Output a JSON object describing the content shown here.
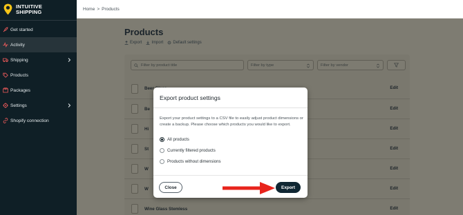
{
  "brand": {
    "line1": "INTUITIVE",
    "line2": "SHIPPING",
    "accent": "#f5c518"
  },
  "sidebar": {
    "items": [
      {
        "label": "Get started",
        "icon": "rocket-icon"
      },
      {
        "label": "Activity",
        "icon": "activity-icon",
        "active": true
      },
      {
        "label": "Shipping",
        "icon": "truck-icon",
        "has_children": true
      },
      {
        "label": "Products",
        "icon": "tag-icon"
      },
      {
        "label": "Packages",
        "icon": "package-icon"
      },
      {
        "label": "Settings",
        "icon": "gear-icon",
        "has_children": true
      },
      {
        "label": "Shopify connection",
        "icon": "link-icon"
      }
    ]
  },
  "breadcrumb": {
    "home": "Home",
    "separator": ">",
    "current": "Products"
  },
  "page": {
    "title": "Products",
    "actions": {
      "export": "Export",
      "import": "Import",
      "default_settings": "Default settings"
    },
    "filters": {
      "search_placeholder": "Filter by product title",
      "type_placeholder": "Filter by type",
      "vendor_placeholder": "Filter by vendor"
    },
    "edit_label": "Edit",
    "products": [
      {
        "name": "Beer Glass"
      },
      {
        "name": "Be"
      },
      {
        "name": "Hi"
      },
      {
        "name": "St"
      },
      {
        "name": "W"
      },
      {
        "name": "W"
      },
      {
        "name": "Wine Glass Stemless"
      }
    ]
  },
  "modal": {
    "title": "Export product settings",
    "description": "Export your product settings to a CSV file to easily adjust product dimensions or create a backup. Please choose which products you would like to export.",
    "options": [
      {
        "label": "All products",
        "selected": true
      },
      {
        "label": "Currently filtered products",
        "selected": false
      },
      {
        "label": "Products without dimensions",
        "selected": false
      }
    ],
    "close_label": "Close",
    "export_label": "Export",
    "arrow_color": "#e8241c"
  }
}
